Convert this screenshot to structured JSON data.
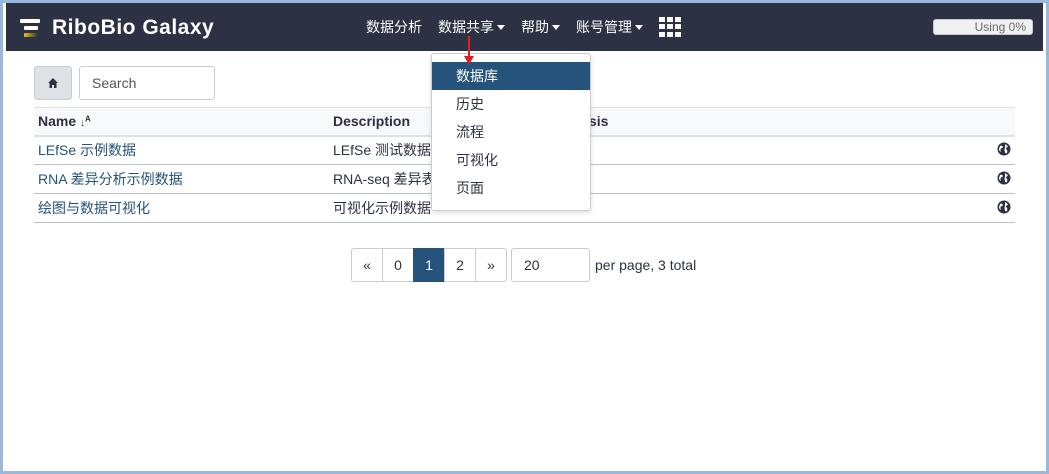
{
  "brand": {
    "title": "RiboBio Galaxy"
  },
  "nav": {
    "items": [
      {
        "label": "数据分析",
        "dropdown": false
      },
      {
        "label": "数据共享",
        "dropdown": true
      },
      {
        "label": "帮助",
        "dropdown": true
      },
      {
        "label": "账号管理",
        "dropdown": true
      }
    ]
  },
  "quota": {
    "label": "Using 0%"
  },
  "search": {
    "placeholder": "Search"
  },
  "table": {
    "headers": [
      "Name",
      "Description",
      "sis"
    ],
    "rows": [
      {
        "name": "LEfSe 示例数据",
        "description": "LEfSe 测试数据。"
      },
      {
        "name": "RNA 差异分析示例数据",
        "description": "RNA-seq 差异表"
      },
      {
        "name": "绘图与数据可视化",
        "description": "可视化示例数据"
      }
    ]
  },
  "pager": {
    "prev": "«",
    "pages": [
      "0",
      "1",
      "2"
    ],
    "active": "1",
    "next": "»",
    "per_page": "20",
    "summary": "per page, 3 total"
  },
  "dropdown": {
    "items": [
      "数据库",
      "历史",
      "流程",
      "可视化",
      "页面"
    ],
    "active_index": 0
  },
  "colors": {
    "masthead": "#2c3143",
    "accent": "#25537b",
    "annotation_arrow": "#e02020"
  }
}
